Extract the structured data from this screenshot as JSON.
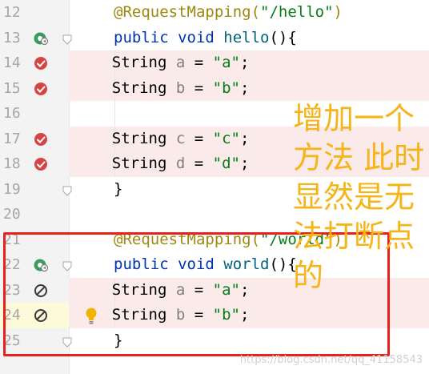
{
  "gutter_icons": {
    "implemented": "implemented-method-icon",
    "breakpoint": "breakpoint-icon",
    "disabled": "disabled-breakpoint-icon",
    "fold": "fold-marker-icon",
    "bulb": "intention-bulb-icon"
  },
  "colors": {
    "breakpoint_red": "#d64545",
    "line_highlight": "#fbeaea",
    "caret_line": "#fcfad9",
    "annotation": "#9e880d",
    "keyword": "#0033b3",
    "method": "#00627a",
    "string": "#067d17",
    "variable": "#808080",
    "red_box": "#e8211d",
    "overlay_text": "#f5b417"
  },
  "lines": [
    {
      "num": "12",
      "parts": [
        {
          "t": "@RequestMapping(",
          "c": "ann"
        },
        {
          "t": "\"/hello\"",
          "c": "str"
        },
        {
          "t": ")",
          "c": "ann"
        }
      ]
    },
    {
      "num": "13",
      "parts": [
        {
          "t": "public ",
          "c": "kw"
        },
        {
          "t": "void ",
          "c": "kw"
        },
        {
          "t": "hello",
          "c": "fn"
        },
        {
          "t": "(){",
          "c": ""
        }
      ]
    },
    {
      "num": "14",
      "parts": [
        {
          "t": "    String ",
          "c": ""
        },
        {
          "t": "a",
          "c": "var"
        },
        {
          "t": " = ",
          "c": ""
        },
        {
          "t": "\"a\"",
          "c": "str"
        },
        {
          "t": ";",
          "c": ""
        }
      ]
    },
    {
      "num": "15",
      "parts": [
        {
          "t": "    String ",
          "c": ""
        },
        {
          "t": "b",
          "c": "var"
        },
        {
          "t": " = ",
          "c": ""
        },
        {
          "t": "\"b\"",
          "c": "str"
        },
        {
          "t": ";",
          "c": ""
        }
      ]
    },
    {
      "num": "16",
      "parts": []
    },
    {
      "num": "17",
      "parts": [
        {
          "t": "    String ",
          "c": ""
        },
        {
          "t": "c",
          "c": "var"
        },
        {
          "t": " = ",
          "c": ""
        },
        {
          "t": "\"c\"",
          "c": "str"
        },
        {
          "t": ";",
          "c": ""
        }
      ]
    },
    {
      "num": "18",
      "parts": [
        {
          "t": "    String ",
          "c": ""
        },
        {
          "t": "d",
          "c": "var"
        },
        {
          "t": " = ",
          "c": ""
        },
        {
          "t": "\"d\"",
          "c": "str"
        },
        {
          "t": ";",
          "c": ""
        }
      ]
    },
    {
      "num": "19",
      "parts": [
        {
          "t": "}",
          "c": ""
        }
      ]
    },
    {
      "num": "20",
      "parts": []
    },
    {
      "num": "21",
      "parts": [
        {
          "t": "@RequestMapping(",
          "c": "ann"
        },
        {
          "t": "\"/world\"",
          "c": "str"
        },
        {
          "t": ")",
          "c": "ann"
        }
      ]
    },
    {
      "num": "22",
      "parts": [
        {
          "t": "public ",
          "c": "kw"
        },
        {
          "t": "void ",
          "c": "kw"
        },
        {
          "t": "world",
          "c": "fn"
        },
        {
          "t": "(){",
          "c": ""
        }
      ]
    },
    {
      "num": "23",
      "parts": [
        {
          "t": "    String ",
          "c": ""
        },
        {
          "t": "a",
          "c": "var"
        },
        {
          "t": " = ",
          "c": ""
        },
        {
          "t": "\"a\"",
          "c": "str"
        },
        {
          "t": ";",
          "c": ""
        }
      ]
    },
    {
      "num": "24",
      "parts": [
        {
          "t": "    String ",
          "c": ""
        },
        {
          "t": "b",
          "c": "var"
        },
        {
          "t": " = ",
          "c": ""
        },
        {
          "t": "\"b\"",
          "c": "str"
        },
        {
          "t": ";",
          "c": ""
        }
      ]
    },
    {
      "num": "25",
      "parts": [
        {
          "t": "}",
          "c": ""
        }
      ]
    }
  ],
  "overlay": {
    "text": "增加一个方法 此时显然是无法打断点的"
  },
  "watermark": "https://blog.csdn.net/qq_41158543"
}
